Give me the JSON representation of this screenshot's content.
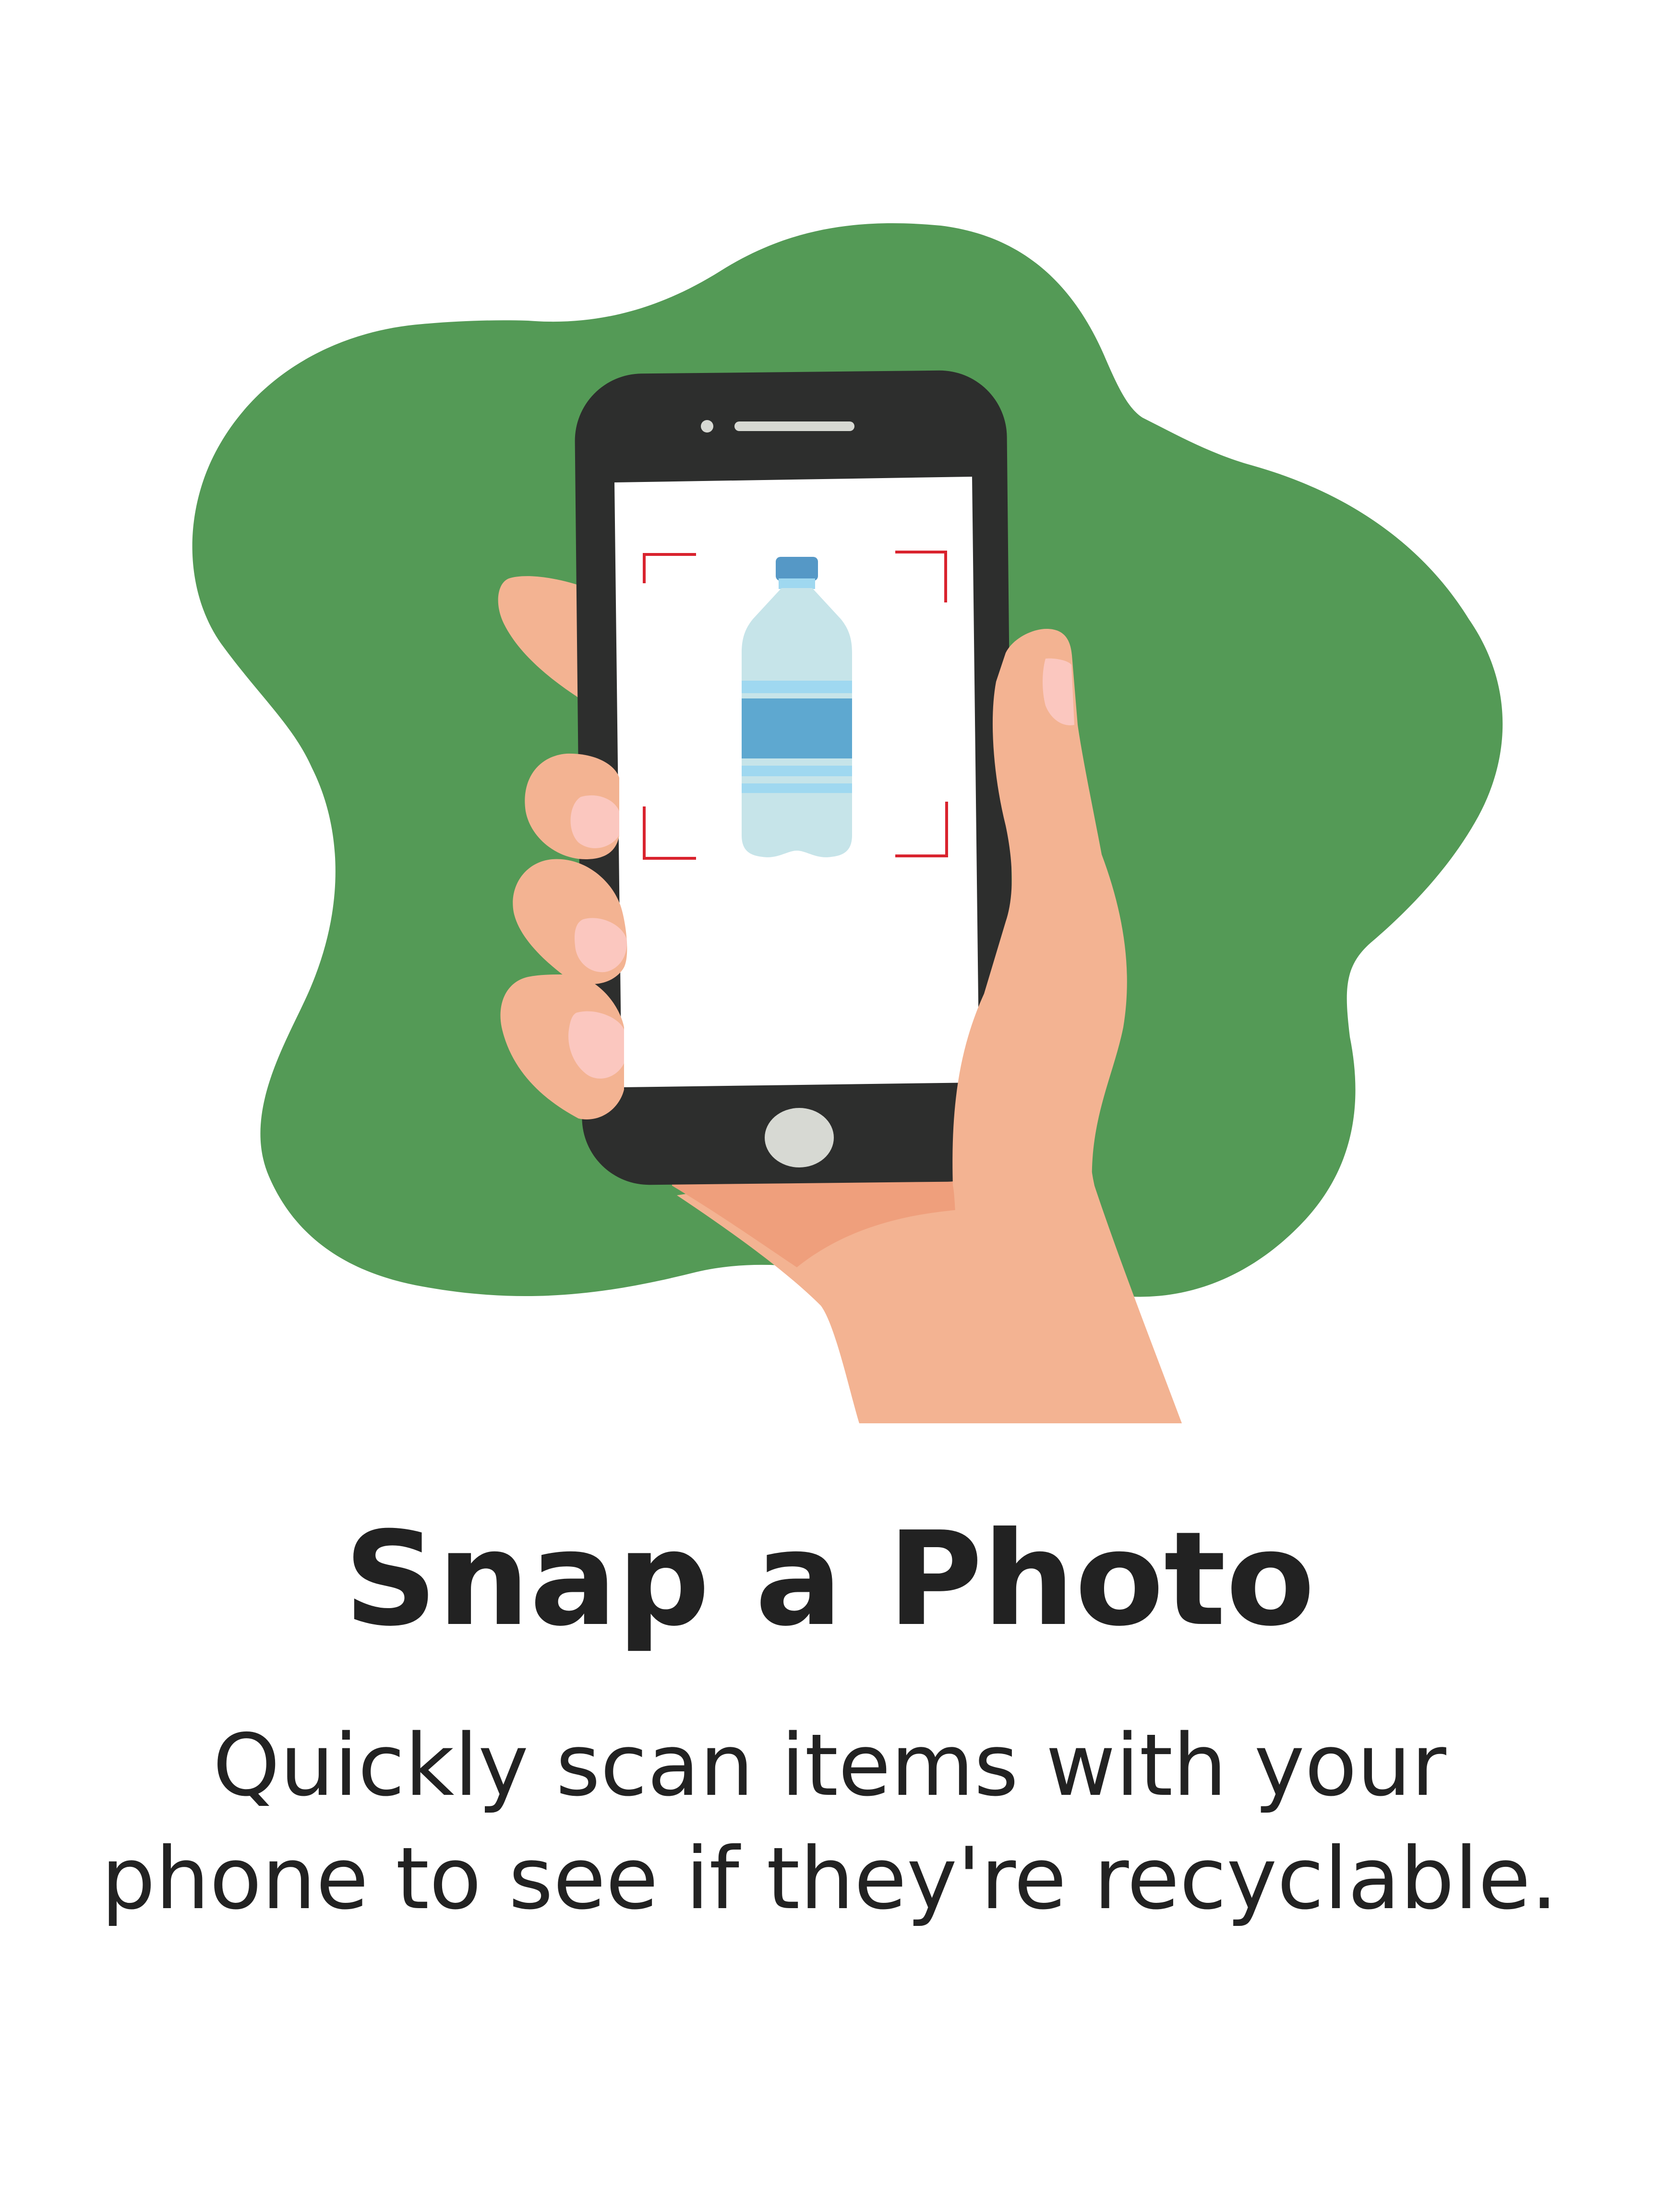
{
  "heading": "Snap a Photo",
  "description": "Quickly scan items with your phone to see if they're recyclable.",
  "illustration": {
    "subject": "hand holding smartphone scanning plastic bottle",
    "colors": {
      "blob": "#549a56",
      "skin": "#f3b392",
      "skin_shadow": "#ef9f7c",
      "nail": "#fbc7bf",
      "phone_body": "#2d2e2d",
      "phone_screen": "#ffffff",
      "home_button": "#d7d9d3",
      "scan_frame": "#d9232e",
      "bottle_body": "#c6e4e9",
      "bottle_label": "#5ea8d0",
      "bottle_stripe": "#9fd8f0",
      "bottle_cap": "#5598c6"
    }
  }
}
